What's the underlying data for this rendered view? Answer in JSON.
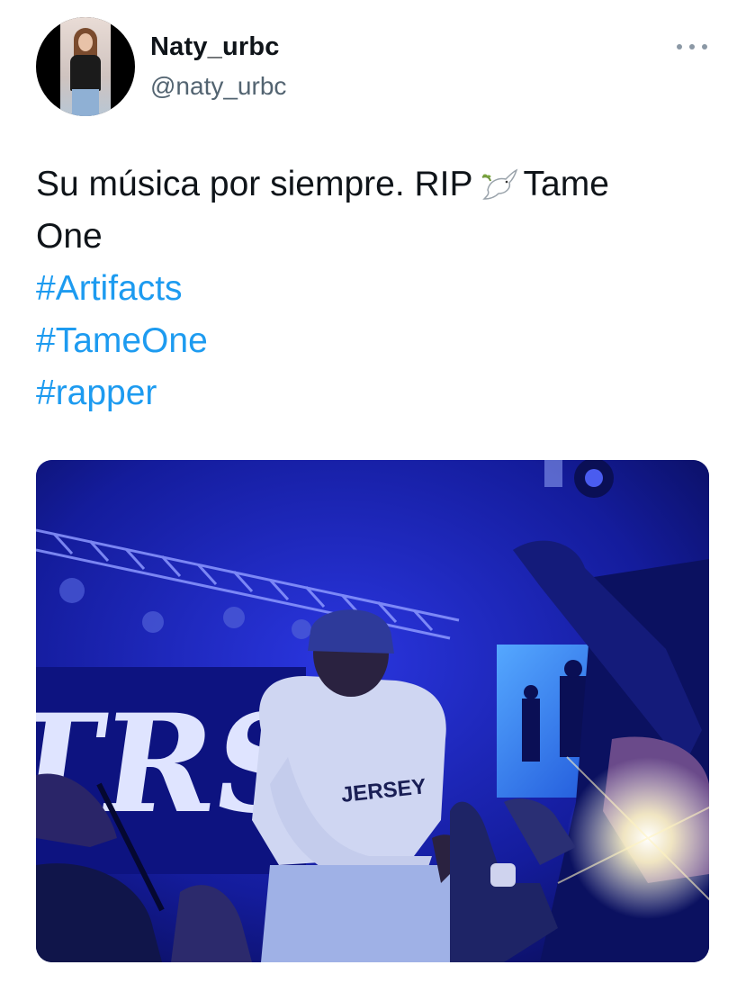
{
  "user": {
    "display_name": "Naty_urbc",
    "handle": "@naty_urbc",
    "avatar_icon": "profile-photo"
  },
  "menu": {
    "icon": "more-horizontal-icon"
  },
  "tweet": {
    "text_line1_before": "Su música por siempre. RIP",
    "emoji_icon": "dove-icon",
    "text_line1_after": "Tame",
    "text_line2": "One",
    "hashtags": [
      "#Artifacts",
      "#TameOne",
      "#rapper"
    ]
  },
  "media": {
    "type": "photo",
    "banner_text": "TRS",
    "shirt_text": "JERSEY"
  },
  "colors": {
    "link": "#1d9bf0",
    "text": "#0f1419",
    "secondary": "#536471",
    "photo_blue": "#1a22c8"
  }
}
